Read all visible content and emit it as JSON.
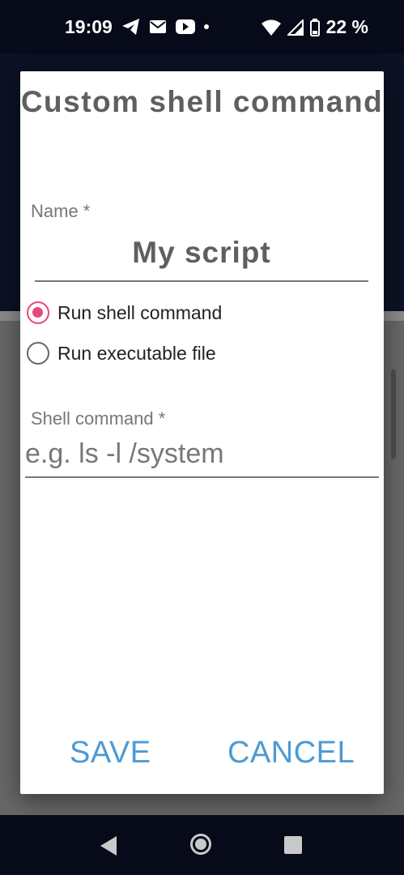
{
  "status_bar": {
    "time": "19:09",
    "battery": "22 %",
    "icons": [
      "telegram-icon",
      "mail-icon",
      "youtube-icon",
      "dot-icon",
      "wifi-icon",
      "signal-icon",
      "battery-icon"
    ]
  },
  "dialog": {
    "title": "Custom shell command",
    "name_label": "Name *",
    "name_value": "My script",
    "options": [
      {
        "label": "Run shell command",
        "checked": true
      },
      {
        "label": "Run executable file",
        "checked": false
      }
    ],
    "shell_label": "Shell command *",
    "shell_placeholder": "e.g. ls -l /system",
    "save_label": "SAVE",
    "cancel_label": "CANCEL"
  },
  "colors": {
    "accent": "#e64a7b",
    "button_text": "#4d9ad4",
    "title_text": "#5f5f5f"
  }
}
